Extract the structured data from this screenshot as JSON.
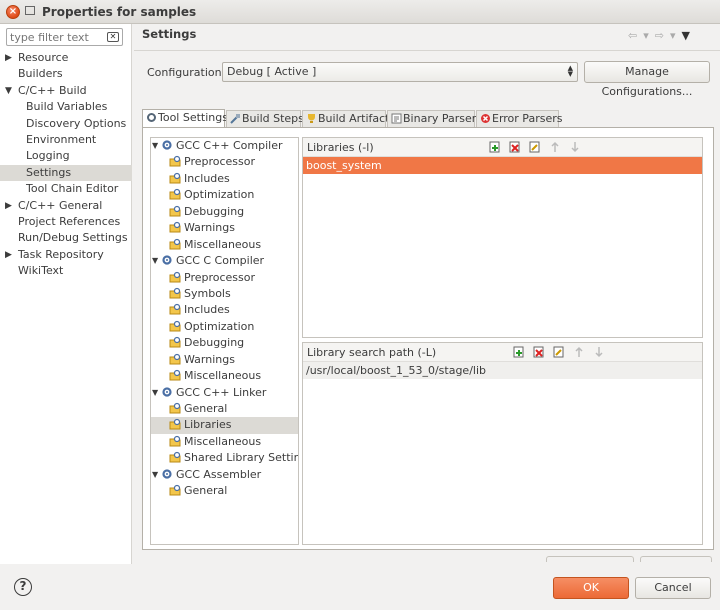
{
  "window": {
    "title": "Properties for samples"
  },
  "filter": {
    "placeholder": "type filter text"
  },
  "nav": {
    "items": [
      {
        "label": "Resource",
        "arrow": "▶"
      },
      {
        "label": "Builders",
        "arrow": ""
      },
      {
        "label": "C/C++ Build",
        "arrow": "▼"
      },
      {
        "label": "Build Variables",
        "child": true
      },
      {
        "label": "Discovery Options",
        "child": true
      },
      {
        "label": "Environment",
        "child": true
      },
      {
        "label": "Logging",
        "child": true
      },
      {
        "label": "Settings",
        "child": true,
        "selected": true
      },
      {
        "label": "Tool Chain Editor",
        "child": true
      },
      {
        "label": "C/C++ General",
        "arrow": "▶"
      },
      {
        "label": "Project References",
        "arrow": ""
      },
      {
        "label": "Run/Debug Settings",
        "arrow": ""
      },
      {
        "label": "Task Repository",
        "arrow": "▶"
      },
      {
        "label": "WikiText",
        "arrow": ""
      }
    ]
  },
  "header": {
    "title": "Settings"
  },
  "config": {
    "label": "Configuration:",
    "value": "Debug  [ Active ]",
    "manage_label": "Manage Configurations..."
  },
  "tabs": [
    {
      "label": "Tool Settings",
      "active": true,
      "icon": "tool-settings-icon"
    },
    {
      "label": "Build Steps",
      "icon": "build-steps-icon"
    },
    {
      "label": "Build Artifact",
      "icon": "build-artifact-icon"
    },
    {
      "label": "Binary Parsers",
      "icon": "binary-parsers-icon"
    },
    {
      "label": "Error Parsers",
      "icon": "error-parsers-icon"
    }
  ],
  "tooltree": {
    "groups": [
      {
        "label": "GCC C++ Compiler",
        "options": [
          "Preprocessor",
          "Includes",
          "Optimization",
          "Debugging",
          "Warnings",
          "Miscellaneous"
        ]
      },
      {
        "label": "GCC C Compiler",
        "options": [
          "Preprocessor",
          "Symbols",
          "Includes",
          "Optimization",
          "Debugging",
          "Warnings",
          "Miscellaneous"
        ]
      },
      {
        "label": "GCC C++ Linker",
        "options": [
          "General",
          "Libraries",
          "Miscellaneous",
          "Shared Library Settings"
        ],
        "selected_option": "Libraries"
      },
      {
        "label": "GCC Assembler",
        "options": [
          "General"
        ]
      }
    ]
  },
  "libraries": {
    "title": "Libraries (-l)",
    "items": [
      "boost_system"
    ]
  },
  "library_paths": {
    "title": "Library search path (-L)",
    "items": [
      "/usr/local/boost_1_53_0/stage/lib"
    ]
  },
  "footer": {
    "ok_label": "OK",
    "cancel_label": "Cancel",
    "help": "?"
  },
  "colors": {
    "accent": "#f07746",
    "ok": "#ec6a36"
  }
}
